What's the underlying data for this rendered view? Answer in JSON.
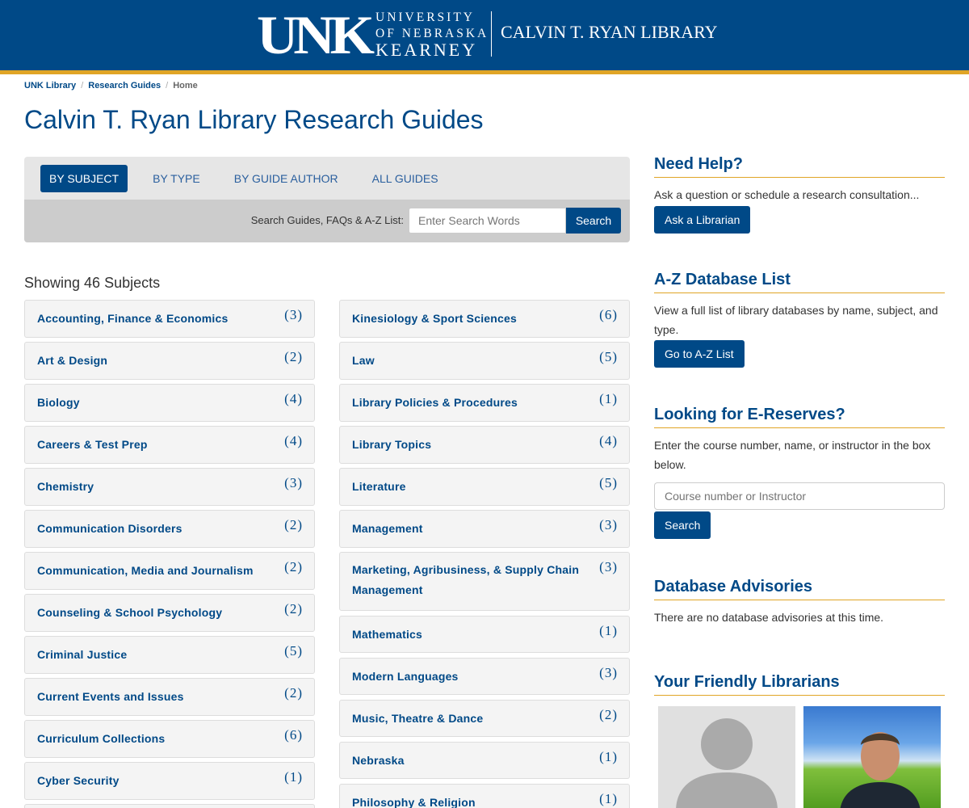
{
  "header": {
    "logo_mark": "UNK",
    "university_line1": "UNIVERSITY",
    "university_line2": "OF NEBRASKA",
    "university_line3": "KEARNEY",
    "library_name": "CALVIN T. RYAN LIBRARY",
    "colors": {
      "brand": "#004987",
      "accent": "#e0a526"
    }
  },
  "breadcrumb": [
    "UNK Library",
    "Research Guides",
    "Home"
  ],
  "page_title": "Calvin T. Ryan Library Research Guides",
  "tabs": [
    {
      "label": "BY SUBJECT",
      "active": true
    },
    {
      "label": "BY TYPE",
      "active": false
    },
    {
      "label": "BY GUIDE AUTHOR",
      "active": false
    },
    {
      "label": "ALL GUIDES",
      "active": false
    }
  ],
  "search": {
    "label": "Search Guides, FAQs & A-Z List:",
    "placeholder": "Enter Search Words",
    "button": "Search"
  },
  "showing": "Showing 46 Subjects",
  "subjects_left": [
    {
      "name": "Accounting, Finance & Economics",
      "count": "(3)"
    },
    {
      "name": "Art & Design",
      "count": "(2)"
    },
    {
      "name": "Biology",
      "count": "(4)"
    },
    {
      "name": "Careers & Test Prep",
      "count": "(4)"
    },
    {
      "name": "Chemistry",
      "count": "(3)"
    },
    {
      "name": "Communication Disorders",
      "count": "(2)"
    },
    {
      "name": "Communication, Media and Journalism",
      "count": "(2)"
    },
    {
      "name": "Counseling & School Psychology",
      "count": "(2)"
    },
    {
      "name": "Criminal Justice",
      "count": "(5)"
    },
    {
      "name": "Current Events and Issues",
      "count": "(2)"
    },
    {
      "name": "Curriculum Collections",
      "count": "(6)"
    },
    {
      "name": "Cyber Security",
      "count": "(1)"
    }
  ],
  "subjects_right": [
    {
      "name": "Kinesiology & Sport Sciences",
      "count": "(6)"
    },
    {
      "name": "Law",
      "count": "(5)"
    },
    {
      "name": "Library Policies & Procedures",
      "count": "(1)"
    },
    {
      "name": "Library Topics",
      "count": "(4)"
    },
    {
      "name": "Literature",
      "count": "(5)"
    },
    {
      "name": "Management",
      "count": "(3)"
    },
    {
      "name": "Marketing, Agribusiness, & Supply Chain Management",
      "count": "(3)"
    },
    {
      "name": "Mathematics",
      "count": "(1)"
    },
    {
      "name": "Modern Languages",
      "count": "(3)"
    },
    {
      "name": "Music, Theatre & Dance",
      "count": "(2)"
    },
    {
      "name": "Nebraska",
      "count": "(1)"
    },
    {
      "name": "Philosophy & Religion",
      "count": "(1)"
    }
  ],
  "sidebar": {
    "help": {
      "title": "Need Help?",
      "text": "Ask a question or schedule a research consultation...",
      "button": "Ask a Librarian"
    },
    "az": {
      "title": "A-Z Database List",
      "text": "View a full list of library databases by name, subject, and type.",
      "button": "Go to A-Z List"
    },
    "ereserves": {
      "title": "Looking for E-Reserves?",
      "text": "Enter the course number, name, or instructor in the box below.",
      "placeholder": "Course number or Instructor",
      "button": "Search"
    },
    "advisories": {
      "title": "Database Advisories",
      "text": "There are no database advisories at this time."
    },
    "librarians": {
      "title": "Your Friendly Librarians"
    }
  }
}
